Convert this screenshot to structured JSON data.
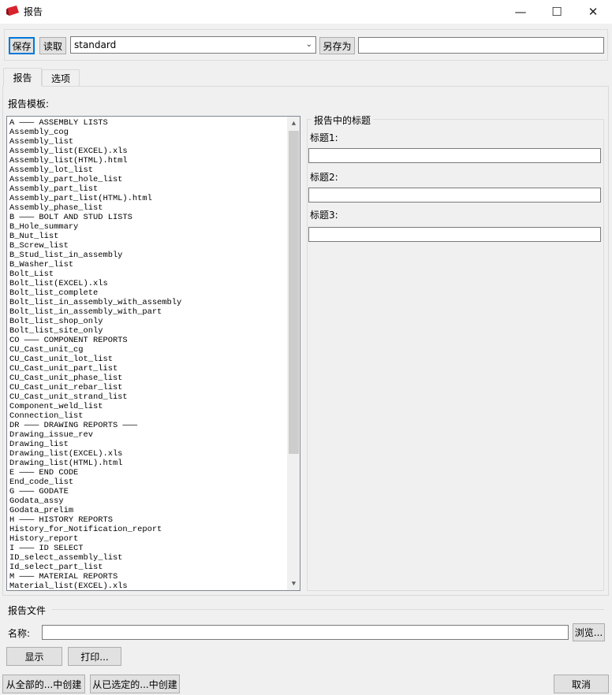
{
  "window": {
    "title": "报告",
    "minimize": "—",
    "maximize": "☐",
    "close": "✕"
  },
  "toolbar": {
    "save_label": "保存",
    "load_label": "读取",
    "settings_value": "standard",
    "save_as_label": "另存为",
    "save_as_value": ""
  },
  "tabs": [
    {
      "label": "报告"
    },
    {
      "label": "选项"
    }
  ],
  "templates": {
    "label": "报告模板:",
    "items": [
      "A ——— ASSEMBLY LISTS",
      "Assembly_cog",
      "Assembly_list",
      "Assembly_list(EXCEL).xls",
      "Assembly_list(HTML).html",
      "Assembly_lot_list",
      "Assembly_part_hole_list",
      "Assembly_part_list",
      "Assembly_part_list(HTML).html",
      "Assembly_phase_list",
      "B ——— BOLT AND STUD LISTS",
      "B_Hole_summary",
      "B_Nut_list",
      "B_Screw_list",
      "B_Stud_list_in_assembly",
      "B_Washer_list",
      "Bolt_List",
      "Bolt_list(EXCEL).xls",
      "Bolt_list_complete",
      "Bolt_list_in_assembly_with_assembly",
      "Bolt_list_in_assembly_with_part",
      "Bolt_list_shop_only",
      "Bolt_list_site_only",
      "CO ——— COMPONENT REPORTS",
      "CU_Cast_unit_cg",
      "CU_Cast_unit_lot_list",
      "CU_Cast_unit_part_list",
      "CU_Cast_unit_phase_list",
      "CU_Cast_unit_rebar_list",
      "CU_Cast_unit_strand_list",
      "Component_weld_list",
      "Connection_list",
      "DR ——— DRAWING REPORTS ———",
      "Drawing_issue_rev",
      "Drawing_list",
      "Drawing_list(EXCEL).xls",
      "Drawing_list(HTML).html",
      "E ——— END CODE",
      "End_code_list",
      "G ——— GODATE",
      "Godata_assy",
      "Godata_prelim",
      "H ——— HISTORY REPORTS",
      "History_for_Notification_report",
      "History_report",
      "I ——— ID SELECT",
      "ID_select_assembly_list",
      "Id_select_part_list",
      "M ——— MATERIAL REPORTS",
      "Material_list(EXCEL).xls"
    ]
  },
  "headings": {
    "group_label": "报告中的标题",
    "fields": [
      {
        "label": "标题1:",
        "value": ""
      },
      {
        "label": "标题2:",
        "value": ""
      },
      {
        "label": "标题3:",
        "value": ""
      }
    ]
  },
  "report_file": {
    "group_label": "报告文件",
    "name_label": "名称:",
    "name_value": "",
    "browse_label": "浏览...",
    "show_label": "显示",
    "print_label": "打印..."
  },
  "footer": {
    "create_all_label": "从全部的...中创建",
    "create_selected_label": "从已选定的...中创建",
    "cancel_label": "取消"
  },
  "colors": {
    "focus": "#0078d7",
    "background": "#f0f0f0",
    "icon_red": "#d9232e"
  }
}
